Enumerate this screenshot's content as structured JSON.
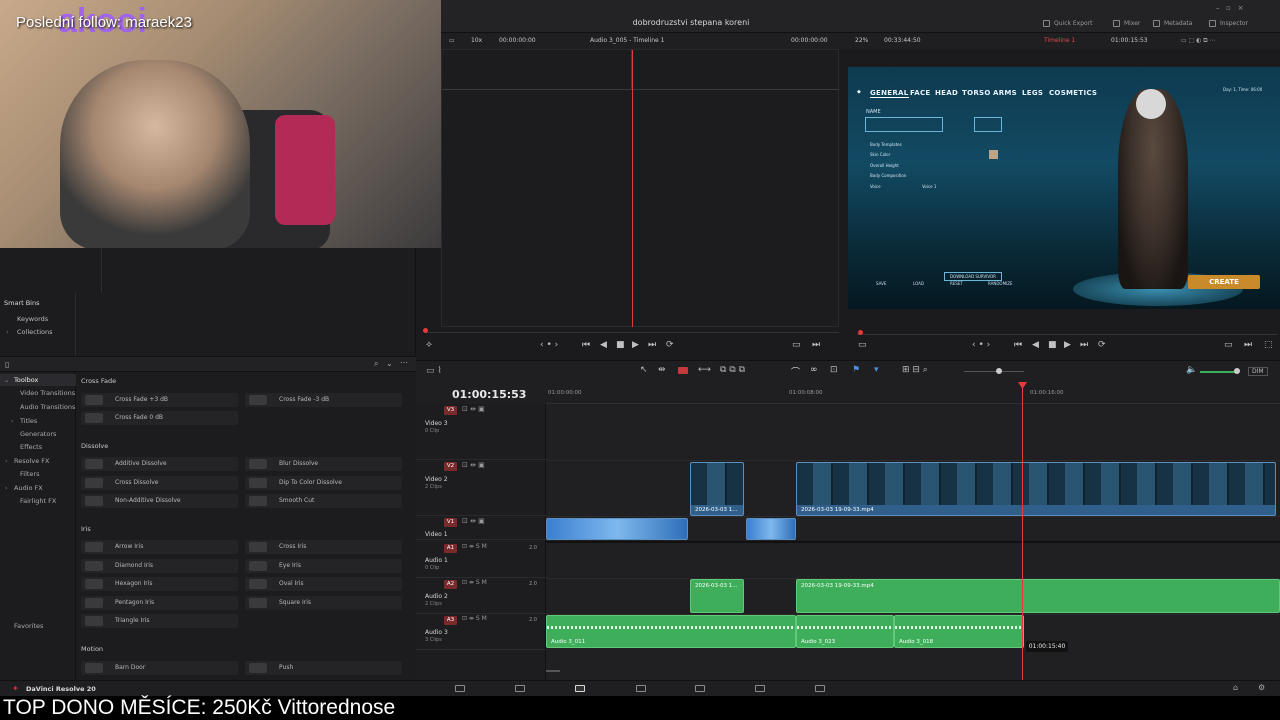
{
  "webcam": {
    "overlay_text": "Poslední follow: maraek23",
    "logo_text": "akooi"
  },
  "header": {
    "project_title": "dobrodruzstvi stepana koreni",
    "quick_export": "Quick Export",
    "mixer": "Mixer",
    "metadata": "Metadata",
    "inspector": "Inspector"
  },
  "source_viewer": {
    "zoom": "10x",
    "timecode_left": "00:00:00:00",
    "clip_name": "Audio 3_005 - Timeline 1",
    "timecode_right": "00:00:00:00"
  },
  "program_viewer": {
    "zoom": "22%",
    "duration": "00:33:44:50",
    "timeline_name": "Timeline 1",
    "timecode": "01:00:15:53",
    "game_menu": [
      "GENERAL",
      "FACE",
      "HEAD",
      "TORSO",
      "ARMS",
      "LEGS",
      "COSMETICS"
    ],
    "game_name_label": "NAME",
    "game_fields": [
      "Body Templates",
      "Skin Color",
      "Overall Height",
      "Body Composition",
      "Voice"
    ],
    "game_voice_value": "Voice 1",
    "game_day_text": "Day: 1, Time: 06:00",
    "game_download": "DOWNLOAD SURVIVOR",
    "game_buttons": [
      "SAVE",
      "LOAD",
      "RESET",
      "RANDOMIZE"
    ],
    "create_label": "CREATE"
  },
  "smart_bins": {
    "title": "Smart Bins",
    "items": [
      "Keywords",
      "Collections"
    ]
  },
  "fx_tree": {
    "toolbox": "Toolbox",
    "items": [
      "Video Transitions",
      "Audio Transitions",
      "Titles",
      "Generators",
      "Effects",
      "Resolve FX",
      "Filters",
      "Audio FX",
      "Fairlight FX"
    ],
    "favorites": "Favorites"
  },
  "fx_list": {
    "categories": [
      "Cross Fade",
      "Dissolve",
      "Iris",
      "Motion"
    ],
    "cross_fade": [
      "Cross Fade +3 dB",
      "Cross Fade -3 dB",
      "Cross Fade 0 dB"
    ],
    "dissolve": [
      "Additive Dissolve",
      "Blur Dissolve",
      "Cross Dissolve",
      "Dip To Color Dissolve",
      "Non-Additive Dissolve",
      "Smooth Cut"
    ],
    "iris": [
      "Arrow Iris",
      "Cross Iris",
      "Diamond Iris",
      "Eye Iris",
      "Hexagon Iris",
      "Oval Iris",
      "Pentagon Iris",
      "Square Iris",
      "Triangle Iris"
    ],
    "motion": [
      "Barn Door",
      "Push"
    ]
  },
  "timeline": {
    "timecode": "01:00:15:53",
    "ruler": [
      "01:00:00:00",
      "01:00:08:00",
      "01:00:16:00"
    ],
    "tracks": [
      {
        "id": "V3",
        "name": "Video 3",
        "sub": "0 Clip"
      },
      {
        "id": "V2",
        "name": "Video 2",
        "sub": "2 Clips"
      },
      {
        "id": "V1",
        "name": "Video 1",
        "sub": ""
      },
      {
        "id": "A1",
        "name": "Audio 1",
        "sub": "0 Clip",
        "vol": "2.0"
      },
      {
        "id": "A2",
        "name": "Audio 2",
        "sub": "2 Clips",
        "vol": "2.0"
      },
      {
        "id": "A3",
        "name": "Audio 3",
        "sub": "3 Clips",
        "vol": "2.0"
      }
    ],
    "clips": {
      "v2_a": "2026-03-03 1...",
      "v2_b": "2026-03-03 19-09-33.mp4",
      "a2_a": "2026-03-03 1...",
      "a2_b": "2026-03-03 19-09-33.mp4",
      "a3_a": "Audio 3_011",
      "a3_b": "Audio 3_023",
      "a3_c": "Audio 3_018"
    },
    "tooltip": "01:00:15:40",
    "dim_label": "DIM"
  },
  "footer": {
    "app_name": "DaVinci Resolve 20",
    "ticker": "TOP DONO MĚSÍCE: 250Kč Vittorednose"
  },
  "colors": {
    "playhead": "#e83a3a",
    "video_clip": "#2f5f8a",
    "audio_clip": "#3fae5a",
    "create_button": "#c98a2a"
  }
}
